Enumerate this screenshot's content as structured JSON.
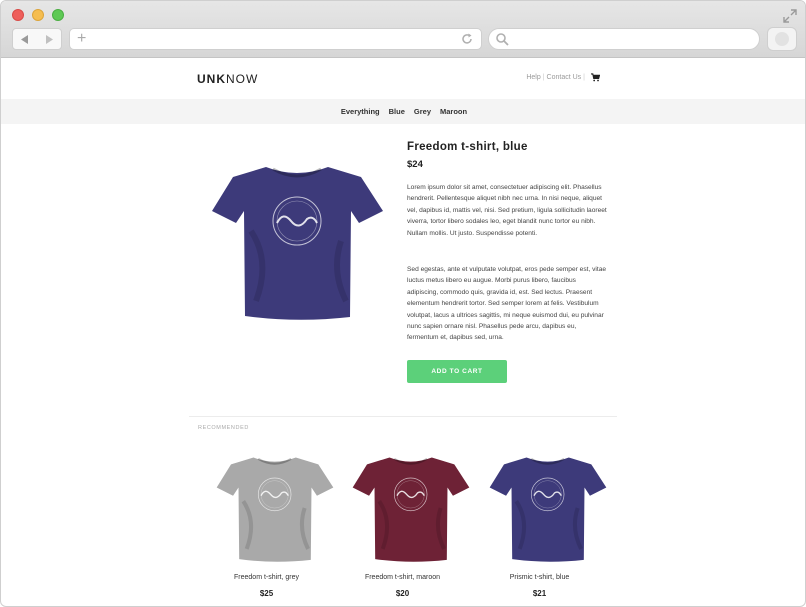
{
  "browser": {
    "url": "",
    "search": ""
  },
  "site": {
    "logo_bold": "UNK",
    "logo_rest": "NOW",
    "util_links": [
      "Help",
      "Contact Us"
    ]
  },
  "categories": [
    "Everything",
    "Blue",
    "Grey",
    "Maroon"
  ],
  "product": {
    "title": "Freedom t-shirt, blue",
    "price": "$24",
    "description": [
      "Lorem ipsum dolor sit amet, consectetuer adipiscing elit. Phasellus hendrerit. Pellentesque aliquet nibh nec urna. In nisi neque, aliquet vel, dapibus id, mattis vel, nisi. Sed pretium, ligula sollicitudin laoreet viverra, tortor libero sodales leo, eget blandit nunc tortor eu nibh. Nullam mollis. Ut justo. Suspendisse potenti.",
      "Sed egestas, ante et vulputate volutpat, eros pede semper est, vitae luctus metus libero eu augue. Morbi purus libero, faucibus adipiscing, commodo quis, gravida id, est. Sed lectus. Praesent elementum hendrerit tortor. Sed semper lorem at felis. Vestibulum volutpat, lacus a ultrices sagittis, mi neque euismod dui, eu pulvinar nunc sapien ornare nisl. Phasellus pede arcu, dapibus eu, fermentum et, dapibus sed, urna."
    ],
    "add_to_cart": "ADD TO CART",
    "shirt_color": "#3d3a7a"
  },
  "recommended": {
    "label": "RECOMMENDED",
    "items": [
      {
        "name": "Freedom t-shirt, grey",
        "price": "$25",
        "color": "#a9a9a9"
      },
      {
        "name": "Freedom t-shirt, maroon",
        "price": "$20",
        "color": "#6e2236"
      },
      {
        "name": "Prismic t-shirt, blue",
        "price": "$21",
        "color": "#3d3a7a"
      }
    ]
  },
  "colors": {
    "accent": "#5cd07a",
    "nav_bg": "#f4f4f4"
  }
}
